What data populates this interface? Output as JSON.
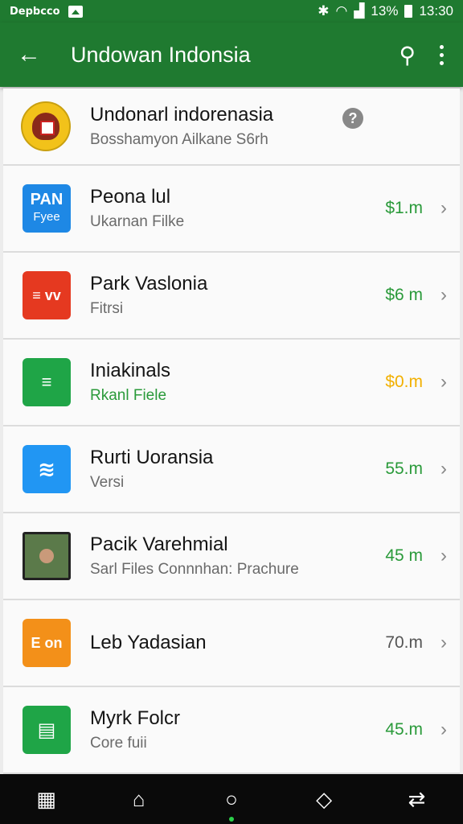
{
  "status": {
    "carrier": "Depbcco",
    "battery": "13%",
    "time": "13:30"
  },
  "appbar": {
    "title": "Undowan Indonsia"
  },
  "list": [
    {
      "name": "Undonarl indorenasia",
      "sub": "Bosshamyon Ailkane S6rh",
      "size": "",
      "icon": "emblem-icon",
      "icon_color": "#f2c21a"
    },
    {
      "name": "Peona lul",
      "sub": "Ukarnan Filke",
      "size": "$1.m",
      "icon": "pan-app-icon",
      "icon_text": "PAN",
      "icon_sub": "Fyee",
      "icon_color": "#1e88e5"
    },
    {
      "name": "Park Vaslonia",
      "sub": "Fitrsi",
      "size": "$6 m",
      "icon": "red-app-icon",
      "icon_text": "≡ vv",
      "icon_color": "#e53920"
    },
    {
      "name": "Iniakinals",
      "sub": "Rkanl Fiele",
      "sub_green": true,
      "size": "$0.m",
      "size_yellow": true,
      "icon": "folder-icon",
      "icon_color": "#1fa547"
    },
    {
      "name": "Rurti Uoransia",
      "sub": "Versi",
      "size": "55.m",
      "icon": "wave-app-icon",
      "icon_color": "#2196f3"
    },
    {
      "name": "Pacik Varehmial",
      "sub": "Sarl Files Connnhan: Prachure",
      "size": "45 m",
      "icon": "photo-thumbnail",
      "icon_color": "#5b7a4a"
    },
    {
      "name": "Leb Yadasian",
      "sub": "",
      "size": "70.m",
      "size_gray": true,
      "icon": "orange-app-icon",
      "icon_text": "E on",
      "icon_color": "#f39019"
    },
    {
      "name": "Myrk Folcr",
      "sub": "Core fuii",
      "size": "45.m",
      "icon": "sheets-icon",
      "icon_color": "#1fa547"
    }
  ]
}
